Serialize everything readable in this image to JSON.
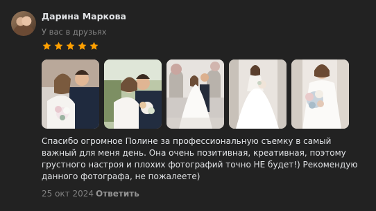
{
  "review": {
    "author_name": "Дарина Маркова",
    "friend_status": "У вас в друзьях",
    "rating": 5,
    "star_color": "#ffa000",
    "photos": [
      "photo-1",
      "photo-2",
      "photo-3",
      "photo-4",
      "photo-5"
    ],
    "text": "Спасибо огромное Полине за профессиональную съемку в самый важный для меня день. Она очень позитивная, креативная, поэтому грустного настроя и плохих фотографий точно НЕ будет!) Рекомендую данного фотографа, не пожалеете)",
    "date": "25 окт 2024",
    "reply_label": "Ответить"
  }
}
